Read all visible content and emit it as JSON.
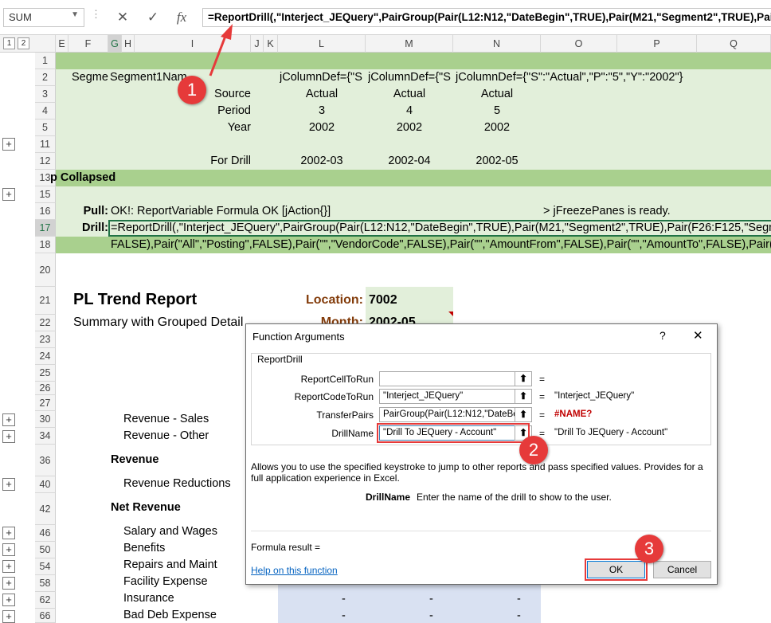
{
  "formula_bar": {
    "name_box": "SUM",
    "cancel": "✕",
    "enter": "✓",
    "fx": "fx",
    "formula": "=ReportDrill(,\"Interject_JEQuery\",PairGroup(Pair(L12:N12,\"DateBegin\",TRUE),Pair(M21,\"Segment2\",TRUE),Pair(F2"
  },
  "outline_levels": [
    "1",
    "2"
  ],
  "columns": [
    "E",
    "F",
    "G",
    "H",
    "I",
    "J",
    "K",
    "L",
    "M",
    "N",
    "O",
    "P",
    "Q"
  ],
  "rows": {
    "r2": {
      "num": "2",
      "f": "Segmer",
      "g": "Segment1Nam",
      "k": "jColumnDef={\"S",
      "l": "jColumnDef={\"S",
      "m": "jColumnDef={\"S\":\"Actual\",\"P\":\"5\",\"Y\":\"2002\"}"
    },
    "r3": {
      "num": "3",
      "label": "Source",
      "l": "Actual",
      "m": "Actual",
      "n": "Actual"
    },
    "r4": {
      "num": "4",
      "label": "Period",
      "l": "3",
      "m": "4",
      "n": "5"
    },
    "r5": {
      "num": "5",
      "label": "Year",
      "l": "2002",
      "m": "2002",
      "n": "2002"
    },
    "r11": {
      "num": "11"
    },
    "r12": {
      "num": "12",
      "label": "For Drill",
      "l": "2002-03",
      "m": "2002-04",
      "n": "2002-05"
    },
    "r13": {
      "num": "13",
      "text": "p Collapsed"
    },
    "r15": {
      "num": "15"
    },
    "r16": {
      "num": "16",
      "label": "Pull:",
      "text": "OK!: ReportVariable Formula OK [jAction{}]",
      "right": "> jFreezePanes is ready."
    },
    "r17": {
      "num": "17",
      "label": "Drill:",
      "text": "=ReportDrill(,\"Interject_JEQuery\",PairGroup(Pair(L12:N12,\"DateBegin\",TRUE),Pair(M21,\"Segment2\",TRUE),Pair(F26:F125,\"Segme"
    },
    "r18": {
      "num": "18",
      "text": "FALSE),Pair(\"All\",\"Posting\",FALSE),Pair(\"\",\"VendorCode\",FALSE),Pair(\"\",\"AmountFrom\",FALSE),Pair(\"\",\"AmountTo\",FALSE),Pair(\"\",\""
    },
    "r20": {
      "num": "20"
    },
    "r21": {
      "num": "21",
      "title": "PL Trend Report",
      "loc_label": "Location:",
      "loc_value": "7002"
    },
    "r22": {
      "num": "22",
      "subtitle": "Summary with Grouped Detail",
      "month_label": "Month:",
      "month_value": "2002-05"
    },
    "r23": {
      "num": "23"
    },
    "r24": {
      "num": "24"
    },
    "r25": {
      "num": "25"
    },
    "r26": {
      "num": "26"
    },
    "r27": {
      "num": "27"
    },
    "r30": {
      "num": "30",
      "text": "Revenue - Sales"
    },
    "r34": {
      "num": "34",
      "text": "Revenue - Other"
    },
    "r36": {
      "num": "36",
      "text": "Revenue"
    },
    "r40": {
      "num": "40",
      "text": "Revenue Reductions"
    },
    "r42": {
      "num": "42",
      "text": "Net Revenue"
    },
    "r46": {
      "num": "46",
      "text": "Salary and Wages"
    },
    "r50": {
      "num": "50",
      "text": "Benefits"
    },
    "r54": {
      "num": "54",
      "text": "Repairs and Maint"
    },
    "r58": {
      "num": "58",
      "text": "Facility Expense"
    },
    "r62": {
      "num": "62",
      "text": "Insurance",
      "dash": "-"
    },
    "r66": {
      "num": "66",
      "text": "Bad Deb Expense",
      "dash": "-"
    }
  },
  "dialog": {
    "title": "Function Arguments",
    "help_q": "?",
    "close": "✕",
    "function_name": "ReportDrill",
    "args": [
      {
        "label": "ReportCellToRun",
        "value": "",
        "result": ""
      },
      {
        "label": "ReportCodeToRun",
        "value": "\"Interject_JEQuery\"",
        "result": "\"Interject_JEQuery\""
      },
      {
        "label": "TransferPairs",
        "value": "PairGroup(Pair(L12:N12,\"DateBe",
        "result": "#NAME?"
      },
      {
        "label": "DrillName",
        "value": "\"Drill To JEQuery - Account\"",
        "result": "\"Drill To JEQuery - Account\""
      }
    ],
    "eq": "=",
    "description": "Allows you to use the specified keystroke to jump to other reports and pass specified values.  Provides for a full application experience in Excel.",
    "arg_help_name": "DrillName",
    "arg_help_text": "Enter the name of the drill to show to the user.",
    "formula_result_label": "Formula result =",
    "help_link": "Help on this function",
    "ok": "OK",
    "cancel": "Cancel"
  },
  "callouts": [
    "1",
    "2",
    "3"
  ],
  "colors": {
    "callout": "#e63a3a",
    "light_green": "#e2efda",
    "dark_green": "#a9d08e",
    "blue_cells": "#d9e1f2",
    "error_red": "#c00000"
  }
}
